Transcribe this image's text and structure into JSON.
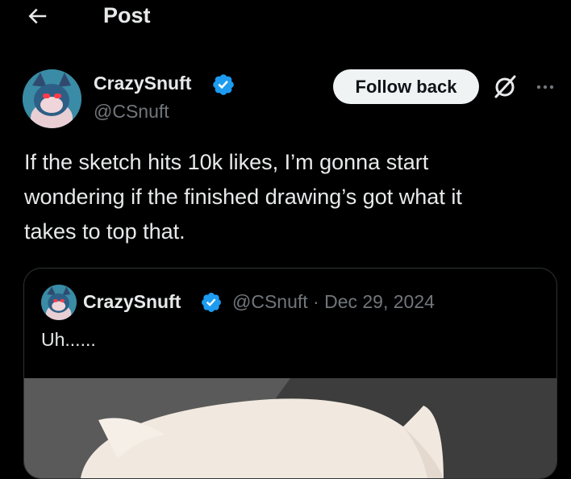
{
  "header": {
    "back_icon": "arrow-left-icon",
    "title": "Post"
  },
  "post": {
    "author": {
      "display_name": "CrazySnuft",
      "handle": "@CSnuft",
      "verified": true,
      "badge_color": "#1d9bf0"
    },
    "follow_button_label": "Follow back",
    "grok_icon": "grok-icon",
    "more_icon": "more-icon",
    "text": "If the sketch hits 10k likes, I’m gonna start\nwondering if the finished drawing’s got what it\ntakes to top that."
  },
  "quote": {
    "author": {
      "display_name": "CrazySnuft",
      "handle": "@CSnuft",
      "verified": true
    },
    "handle_date": "@CSnuft · Dec 29, 2024",
    "text": "Uh......",
    "media_icon": "artwork-image"
  },
  "colors": {
    "background": "#000000",
    "text_primary": "#e7e9ea",
    "text_secondary": "#71767b",
    "border": "#2f3336",
    "accent": "#1d9bf0"
  }
}
